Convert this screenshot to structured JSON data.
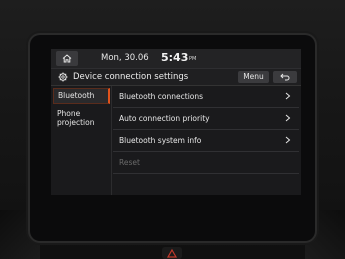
{
  "status": {
    "date": "Mon, 30.06",
    "time": "5:43",
    "ampm": "PM"
  },
  "title_bar": {
    "title": "Device connection settings",
    "menu_label": "Menu"
  },
  "tabs": [
    {
      "label": "Bluetooth",
      "selected": true
    },
    {
      "label": "Phone projection",
      "selected": false
    }
  ],
  "list": [
    {
      "label": "Bluetooth connections",
      "enabled": true
    },
    {
      "label": "Auto connection priority",
      "enabled": true
    },
    {
      "label": "Bluetooth system info",
      "enabled": true
    },
    {
      "label": "Reset",
      "enabled": false
    }
  ],
  "colors": {
    "accent": "#e0531c",
    "screen_bg": "#1a1a1c",
    "text": "#e8e8e8",
    "disabled_text": "#6a6a6a"
  },
  "icons": {
    "home": "home-icon",
    "settings": "gear-icon",
    "back": "back-arrow-icon",
    "chevron": "chevron-right-icon",
    "hazard": "hazard-triangle-icon"
  }
}
